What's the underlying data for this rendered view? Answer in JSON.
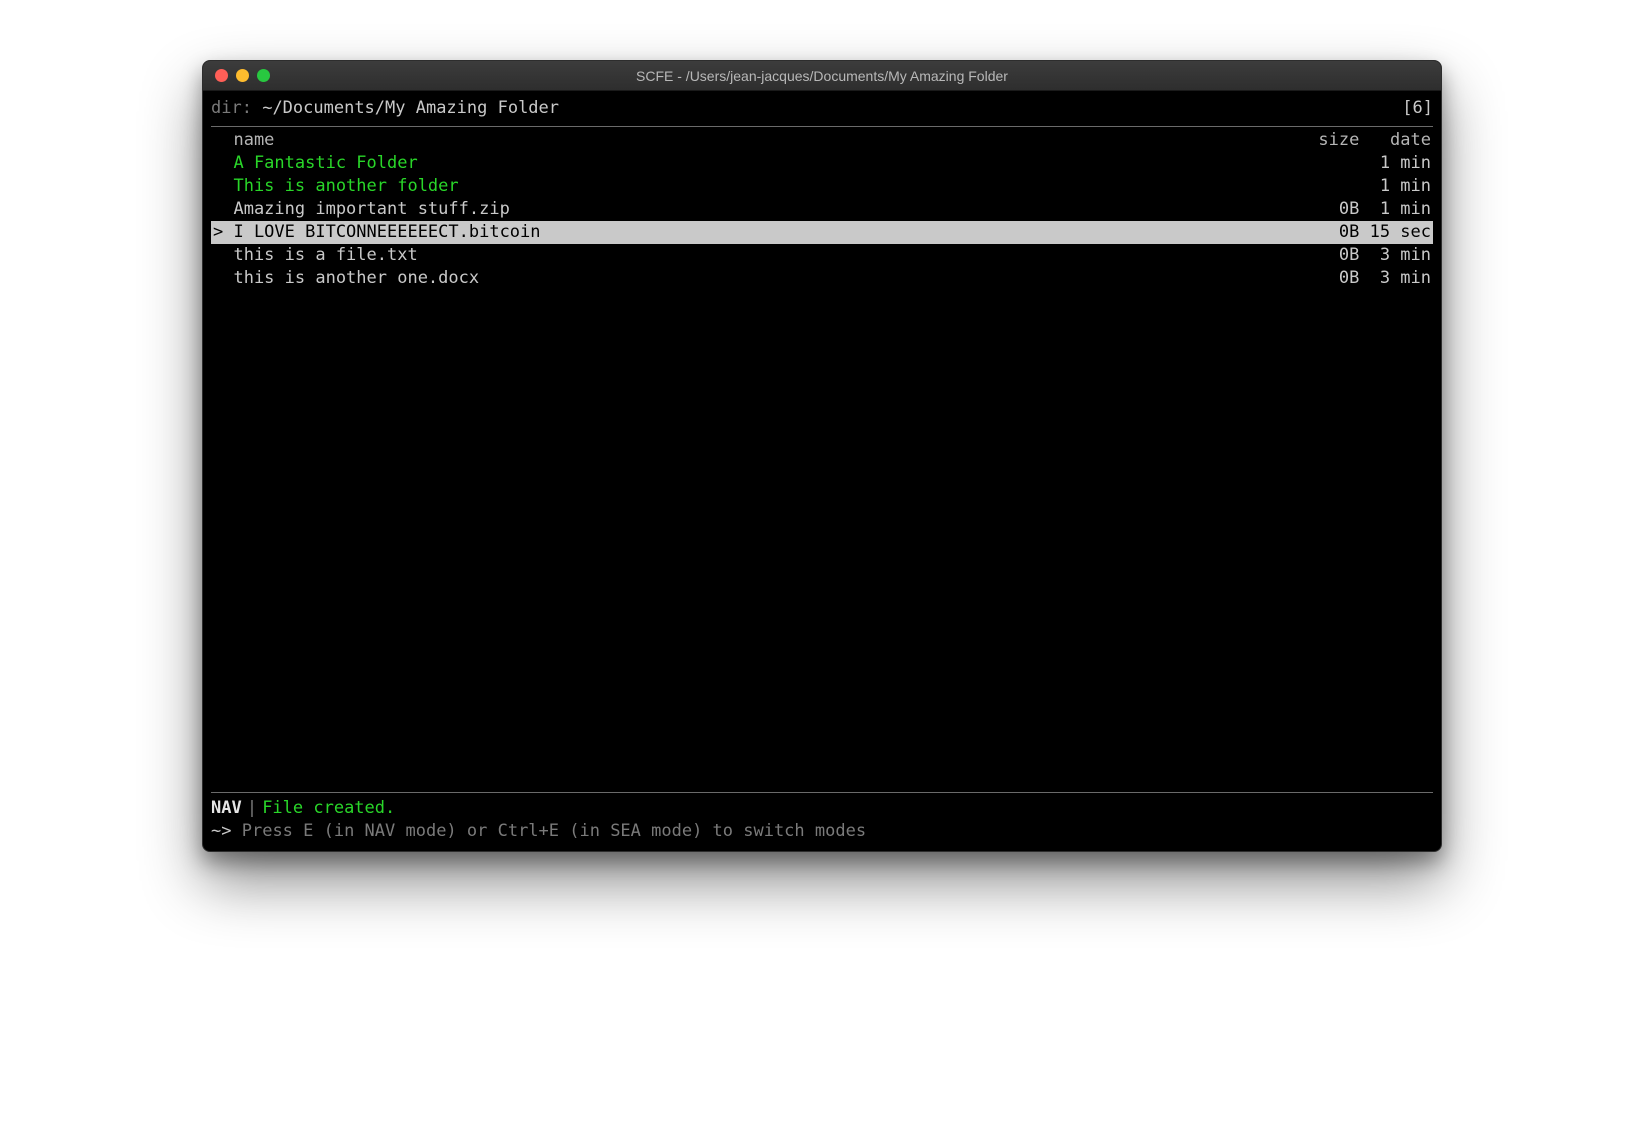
{
  "window": {
    "title": "SCFE - /Users/jean-jacques/Documents/My Amazing  Folder"
  },
  "dir": {
    "label": "dir:",
    "path": "~/Documents/My Amazing  Folder",
    "count_display": "[6]"
  },
  "columns": {
    "name": "name",
    "size": "size",
    "date": "date"
  },
  "entries": [
    {
      "name": "A Fantastic Folder",
      "size": "",
      "date": "1 min",
      "type": "folder",
      "selected": false
    },
    {
      "name": "This is another folder",
      "size": "",
      "date": "1 min",
      "type": "folder",
      "selected": false
    },
    {
      "name": "Amazing important stuff.zip",
      "size": "0B",
      "date": "1 min",
      "type": "file",
      "selected": false
    },
    {
      "name": "I LOVE BITCONNEEEEEECT.bitcoin",
      "size": "0B",
      "date": "15 sec",
      "type": "file",
      "selected": true
    },
    {
      "name": "this is a file.txt",
      "size": "0B",
      "date": "3 min",
      "type": "file",
      "selected": false
    },
    {
      "name": "this is another one.docx",
      "size": "0B",
      "date": "3 min",
      "type": "file",
      "selected": false
    }
  ],
  "status": {
    "mode": "NAV",
    "separator": "|",
    "message": "File created."
  },
  "prompt": {
    "symbol": "~>",
    "hint": "Press E (in NAV mode) or Ctrl+E (in SEA mode) to switch modes"
  }
}
